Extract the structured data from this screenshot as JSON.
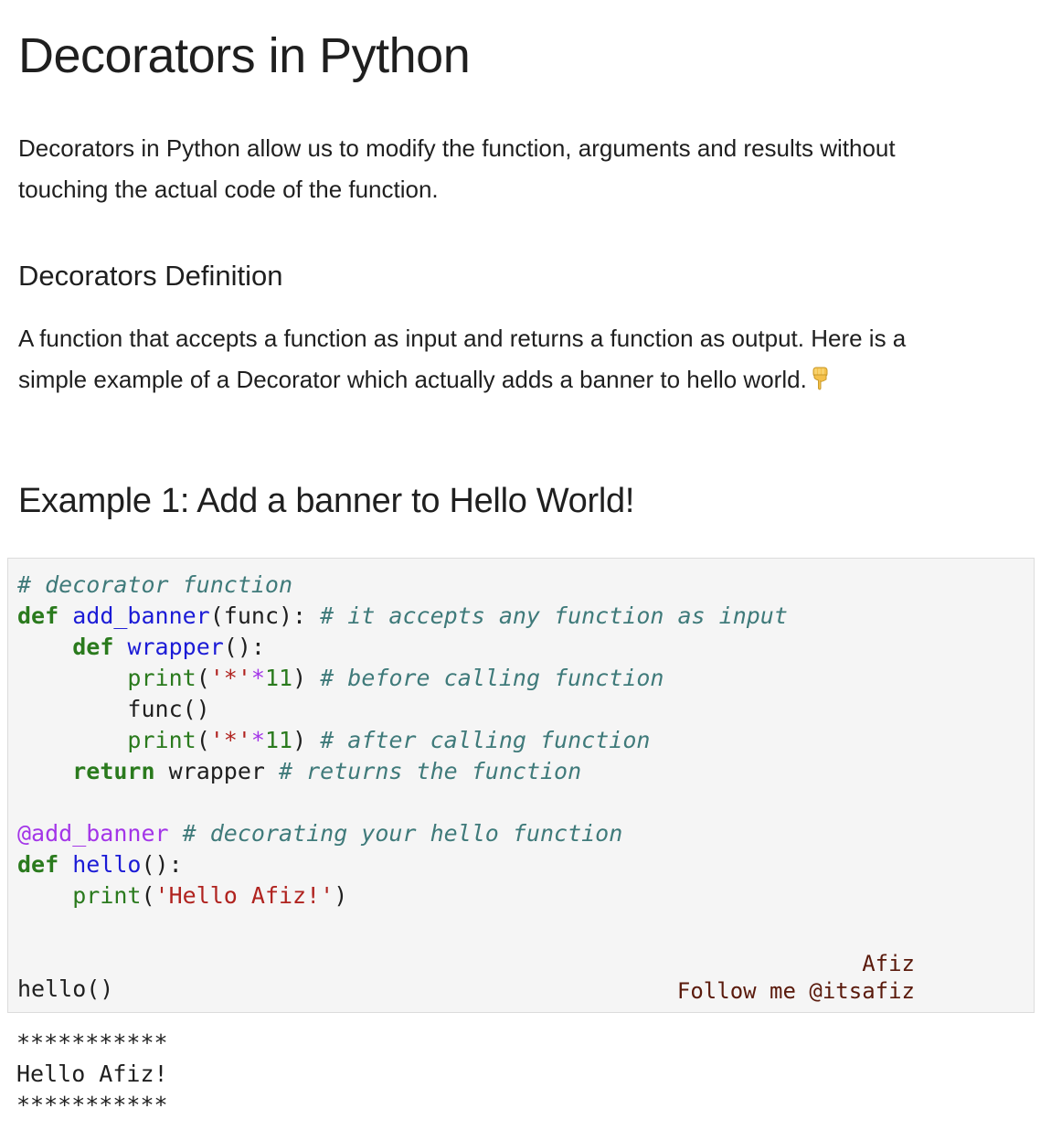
{
  "title": "Decorators in Python",
  "intro": "Decorators in Python allow us to modify the function, arguments and results without touching the actual code of the function.",
  "definition_heading": "Decorators Definition",
  "definition_text": "A function that accepts a function as input and returns a function as output. Here is a simple example of a Decorator which actually adds a banner to hello world.",
  "pointer_icon": "backhand-index-pointing-down-icon",
  "example_heading": "Example 1: Add a banner to Hello World!",
  "code": {
    "l1": "# decorator function",
    "l2_kw": "def",
    "l2_fn": "add_banner",
    "l2_args": "(func):",
    "l2_com": "# it accepts any function as input",
    "l3_kw": "def",
    "l3_fn": "wrapper",
    "l3_rest": "():",
    "l4_bi": "print",
    "l4_open": "(",
    "l4_str": "'*'",
    "l4_op": "*",
    "l4_num": "11",
    "l4_close": ")",
    "l4_com": "# before calling function",
    "l5": "func()",
    "l6_bi": "print",
    "l6_open": "(",
    "l6_str": "'*'",
    "l6_op": "*",
    "l6_num": "11",
    "l6_close": ")",
    "l6_com": "# after calling function",
    "l7_kw": "return",
    "l7_rest": "wrapper",
    "l7_com": "# returns the function",
    "l9_dec": "@add_banner",
    "l9_com": "# decorating your hello function",
    "l10_kw": "def",
    "l10_fn": "hello",
    "l10_rest": "():",
    "l11_bi": "print",
    "l11_open": "(",
    "l11_str": "'Hello Afiz!'",
    "l11_close": ")",
    "l14": "hello()"
  },
  "watermark": {
    "name": "Afiz",
    "handle": "Follow me @itsafiz"
  },
  "output": {
    "line1": "***********",
    "line2": "Hello Afiz!",
    "line3": "***********"
  }
}
